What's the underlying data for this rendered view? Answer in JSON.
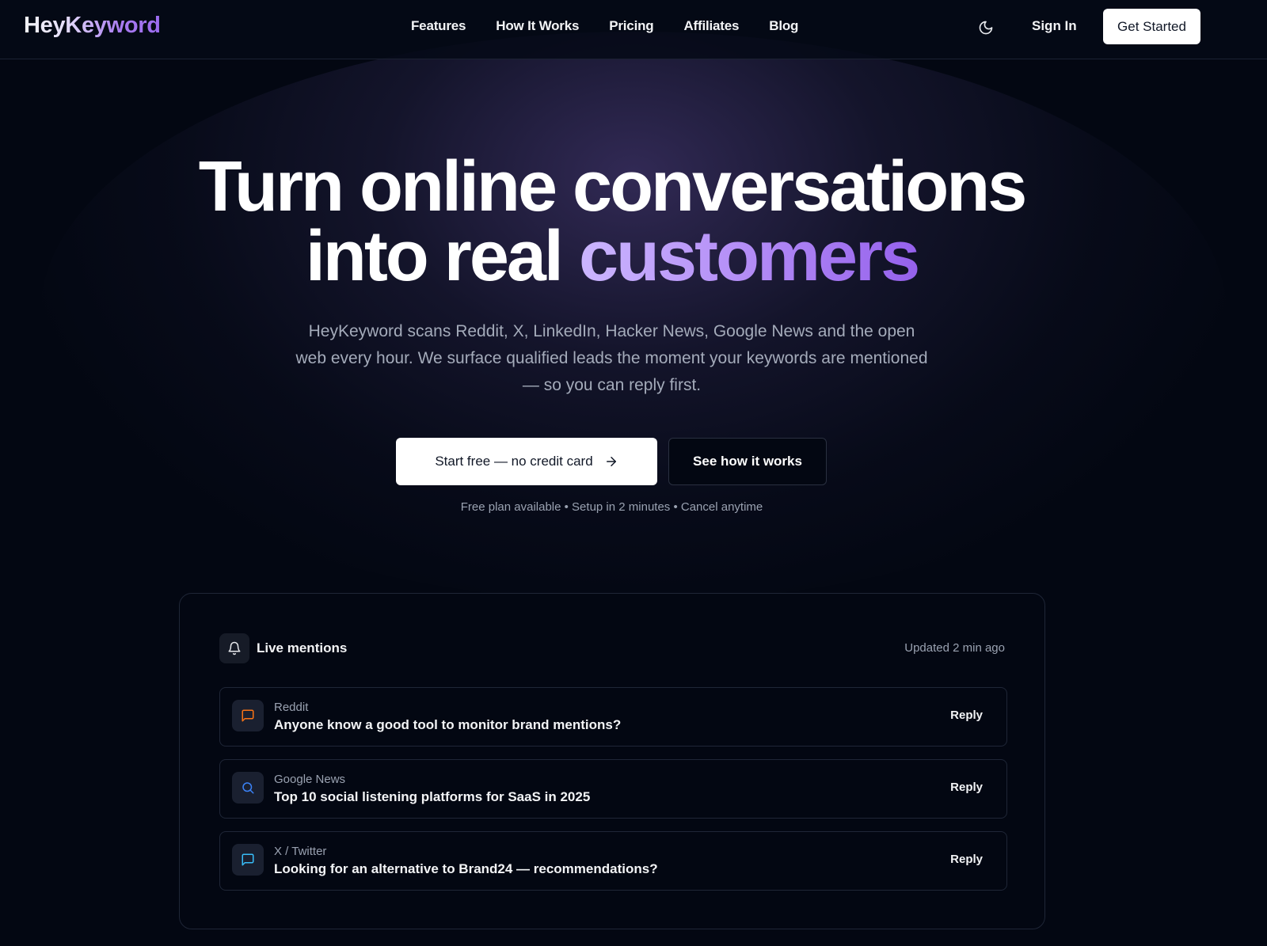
{
  "nav": {
    "logo": "HeyKeyword",
    "links": [
      {
        "label": "Features"
      },
      {
        "label": "How It Works"
      },
      {
        "label": "Pricing"
      },
      {
        "label": "Affiliates"
      },
      {
        "label": "Blog"
      }
    ],
    "theme_icon": "moon-icon",
    "sign_in": "Sign In",
    "get_started": "Get Started"
  },
  "hero": {
    "title_line1": "Turn online conversations",
    "title_line2_plain": "into real",
    "title_line2_accent": "customers",
    "subtitle": "HeyKeyword scans Reddit, X, LinkedIn, Hacker News, Google News and the open web every hour. We surface qualified leads the moment your keywords are mentioned — so you can reply first.",
    "cta_primary": "Start free — no credit card",
    "cta_primary_icon": "arrow-right-icon",
    "cta_secondary": "See how it works",
    "fineprint": "Free plan available • Setup in 2 minutes • Cancel anytime"
  },
  "live": {
    "icon": "bell-icon",
    "title": "Live mentions",
    "updated": "Updated 2 min ago",
    "mentions": [
      {
        "source": "Reddit",
        "title": "Anyone know a good tool to monitor brand mentions?",
        "reply": "Reply",
        "icon": "message-square-icon",
        "icon_color": "#f97316"
      },
      {
        "source": "Google News",
        "title": "Top 10 social listening platforms for SaaS in 2025",
        "reply": "Reply",
        "icon": "search-icon",
        "icon_color": "#3b82f6"
      },
      {
        "source": "X / Twitter",
        "title": "Looking for an alternative to Brand24 — recommendations?",
        "reply": "Reply",
        "icon": "message-square-icon",
        "icon_color": "#38bdf8"
      }
    ]
  },
  "colors": {
    "background": "#030712",
    "accent": "#a97cf0",
    "text": "#f9fafb",
    "muted": "#9aa2b1"
  }
}
